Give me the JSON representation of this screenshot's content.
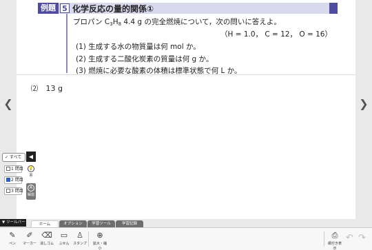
{
  "problem": {
    "tag": "例題",
    "number": "5",
    "title": "化学反応の量的関係①",
    "statement_pre": "プロパン ",
    "formula_c": "C",
    "formula_c_sub": "3",
    "formula_h": "H",
    "formula_h_sub": "8",
    "statement_post": " 4.4 g の完全燃焼について，次の問いに答えよ。",
    "atomic_masses": "（H = 1.0， C = 12， O = 16）",
    "questions": [
      "(1) 生成する水の物質量は何 mol か。",
      "(2) 生成する二酸化炭素の質量は何 g か。",
      "(3) 燃焼に必要な酸素の体積は標準状態で何 L か。"
    ]
  },
  "answer": {
    "number": "⑵",
    "value": "13 g"
  },
  "filters": {
    "all_label": "✓ すべて",
    "items": [
      "1 問目",
      "2 問目",
      "3 問目"
    ],
    "hint_label": "答",
    "explain_label": "解説"
  },
  "toolbar": {
    "toggle_label": "▼ ツールバー",
    "tabs": [
      "ホーム",
      "オプション",
      "学習ツール",
      "学習記録"
    ],
    "tools": [
      {
        "label": "ペン",
        "icon": "pen-icon"
      },
      {
        "label": "マーカー",
        "icon": "marker-icon"
      },
      {
        "label": "消しゴム",
        "icon": "eraser-icon"
      },
      {
        "label": "ふせん",
        "icon": "sticky-note-icon"
      },
      {
        "label": "スタンプ",
        "icon": "stamp-icon"
      },
      {
        "label": "拡大・縮小",
        "icon": "zoom-icon"
      }
    ],
    "right_tool_label": "網付き表示"
  }
}
